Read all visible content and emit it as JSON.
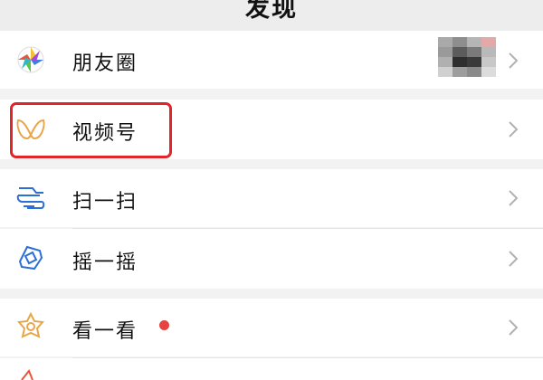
{
  "header": {
    "title": "发现"
  },
  "items": [
    {
      "id": "moments",
      "label": "朋友圈",
      "icon": "moments-icon"
    },
    {
      "id": "channels",
      "label": "视频号",
      "icon": "channels-icon"
    },
    {
      "id": "scan",
      "label": "扫一扫",
      "icon": "scan-icon"
    },
    {
      "id": "shake",
      "label": "摇一摇",
      "icon": "shake-icon"
    },
    {
      "id": "top-stories",
      "label": "看一看",
      "icon": "top-stories-icon"
    }
  ],
  "colors": {
    "highlight_border": "#e0262a",
    "notification_dot": "#e64340",
    "channels_icon": "#e8a64a",
    "scan_shake_icon": "#2b6fd6"
  }
}
